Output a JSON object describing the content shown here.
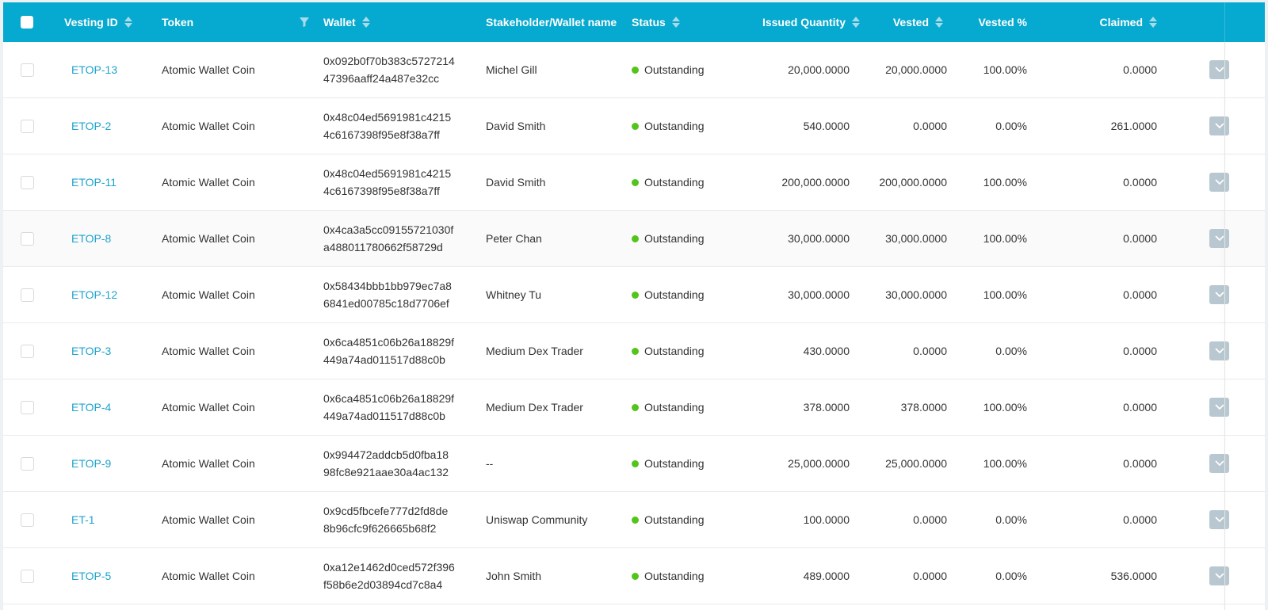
{
  "header": {
    "vesting_id": "Vesting ID",
    "token": "Token",
    "wallet": "Wallet",
    "stakeholder": "Stakeholder/Wallet name",
    "status": "Status",
    "issued": "Issued Quantity",
    "vested": "Vested",
    "vested_pct": "Vested %",
    "claimed": "Claimed"
  },
  "colors": {
    "header_bg": "#06a9cf",
    "link": "#1ea3cc",
    "status_dot": "#52c41a",
    "expand_btn": "#b8c7d0"
  },
  "rows": [
    {
      "id": "ETOP-13",
      "token": "Atomic Wallet Coin",
      "wallet1": "0x092b0f70b383c5727214",
      "wallet2": "47396aaff24a487e32cc",
      "name": "Michel Gill",
      "status": "Outstanding",
      "issued": "20,000.0000",
      "vested": "20,000.0000",
      "pct": "100.00%",
      "claimed": "0.0000"
    },
    {
      "id": "ETOP-2",
      "token": "Atomic Wallet Coin",
      "wallet1": "0x48c04ed5691981c4215",
      "wallet2": "4c6167398f95e8f38a7ff",
      "name": "David Smith",
      "status": "Outstanding",
      "issued": "540.0000",
      "vested": "0.0000",
      "pct": "0.00%",
      "claimed": "261.0000"
    },
    {
      "id": "ETOP-11",
      "token": "Atomic Wallet Coin",
      "wallet1": "0x48c04ed5691981c4215",
      "wallet2": "4c6167398f95e8f38a7ff",
      "name": "David Smith",
      "status": "Outstanding",
      "issued": "200,000.0000",
      "vested": "200,000.0000",
      "pct": "100.00%",
      "claimed": "0.0000"
    },
    {
      "id": "ETOP-8",
      "token": "Atomic Wallet Coin",
      "wallet1": "0x4ca3a5cc09155721030f",
      "wallet2": "a488011780662f58729d",
      "name": "Peter Chan",
      "status": "Outstanding",
      "issued": "30,000.0000",
      "vested": "30,000.0000",
      "pct": "100.00%",
      "claimed": "0.0000"
    },
    {
      "id": "ETOP-12",
      "token": "Atomic Wallet Coin",
      "wallet1": "0x58434bbb1bb979ec7a8",
      "wallet2": "6841ed00785c18d7706ef",
      "name": "Whitney Tu",
      "status": "Outstanding",
      "issued": "30,000.0000",
      "vested": "30,000.0000",
      "pct": "100.00%",
      "claimed": "0.0000"
    },
    {
      "id": "ETOP-3",
      "token": "Atomic Wallet Coin",
      "wallet1": "0x6ca4851c06b26a18829f",
      "wallet2": "449a74ad011517d88c0b",
      "name": "Medium Dex Trader",
      "status": "Outstanding",
      "issued": "430.0000",
      "vested": "0.0000",
      "pct": "0.00%",
      "claimed": "0.0000"
    },
    {
      "id": "ETOP-4",
      "token": "Atomic Wallet Coin",
      "wallet1": "0x6ca4851c06b26a18829f",
      "wallet2": "449a74ad011517d88c0b",
      "name": "Medium Dex Trader",
      "status": "Outstanding",
      "issued": "378.0000",
      "vested": "378.0000",
      "pct": "100.00%",
      "claimed": "0.0000"
    },
    {
      "id": "ETOP-9",
      "token": "Atomic Wallet Coin",
      "wallet1": "0x994472addcb5d0fba18",
      "wallet2": "98fc8e921aae30a4ac132",
      "name": "--",
      "status": "Outstanding",
      "issued": "25,000.0000",
      "vested": "25,000.0000",
      "pct": "100.00%",
      "claimed": "0.0000"
    },
    {
      "id": "ET-1",
      "token": "Atomic Wallet Coin",
      "wallet1": "0x9cd5fbcefe777d2fd8de",
      "wallet2": "8b96cfc9f626665b68f2",
      "name": "Uniswap Community",
      "status": "Outstanding",
      "issued": "100.0000",
      "vested": "0.0000",
      "pct": "0.00%",
      "claimed": "0.0000"
    },
    {
      "id": "ETOP-5",
      "token": "Atomic Wallet Coin",
      "wallet1": "0xa12e1462d0ced572f396",
      "wallet2": "f58b6e2d03894cd7c8a4",
      "name": "John Smith",
      "status": "Outstanding",
      "issued": "489.0000",
      "vested": "0.0000",
      "pct": "0.00%",
      "claimed": "536.0000"
    }
  ]
}
